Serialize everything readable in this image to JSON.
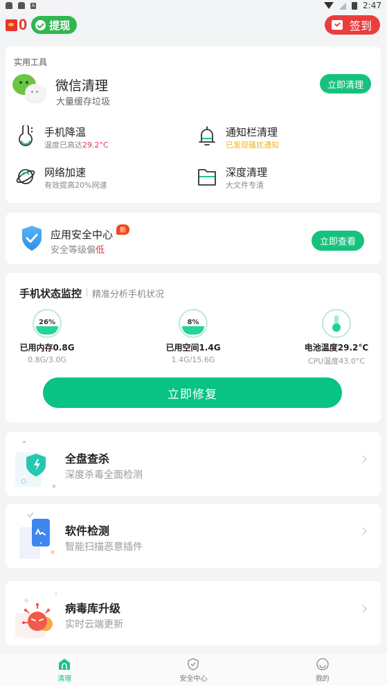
{
  "status_bar": {
    "time": "2:47",
    "left_icons": [
      "notification-icon",
      "notification-icon",
      "app-icon-a"
    ],
    "right_icons": [
      "wifi-icon",
      "no-signal-icon",
      "battery-charging-icon"
    ],
    "app_icon_letter": "A"
  },
  "header": {
    "coin_count": "0",
    "withdraw_label": "提现",
    "checkin_label": "签到"
  },
  "tools": {
    "section_title": "实用工具",
    "wechat": {
      "title": "微信清理",
      "subtitle": "大量缓存垃圾",
      "button": "立即清理"
    },
    "items": [
      {
        "name": "手机降温",
        "sub_prefix": "温度已高达",
        "sub_highlight": "29.2°C",
        "icon": "thermometer-bulb-icon"
      },
      {
        "name": "通知栏清理",
        "sub_highlight": "已发现骚扰通知",
        "icon": "bell-icon"
      },
      {
        "name": "网络加速",
        "sub_prefix": "有效提高20%网速",
        "icon": "planet-icon"
      },
      {
        "name": "深度清理",
        "sub_prefix": "大文件专清",
        "icon": "folder-icon"
      }
    ]
  },
  "security_center": {
    "title": "应用安全中心",
    "badge": "新",
    "subtitle_prefix": "安全等级偏",
    "subtitle_highlight": "低",
    "button": "立即查看"
  },
  "monitor": {
    "title": "手机状态监控",
    "subtitle": "精准分析手机状况",
    "gauges": [
      {
        "percent_label": "26%",
        "percent": 26,
        "label": "已用内存0.8G",
        "sub": "0.8G/3.0G"
      },
      {
        "percent_label": "8%",
        "percent": 8,
        "label": "已用空间1.4G",
        "sub": "1.4G/15.6G"
      },
      {
        "label": "电池温度29.2°C",
        "sub": "CPU温度43.0°C"
      }
    ],
    "fix_button": "立即修复"
  },
  "features": [
    {
      "title": "全盘查杀",
      "subtitle": "深度杀毒全面检测"
    },
    {
      "title": "软件检测",
      "subtitle": "智能扫描恶意插件"
    },
    {
      "title": "病毒库升级",
      "subtitle": "实时云端更新"
    }
  ],
  "tabbar": {
    "tabs": [
      {
        "label": "清理",
        "active": true
      },
      {
        "label": "安全中心",
        "active": false
      },
      {
        "label": "我的",
        "active": false
      }
    ]
  },
  "colors": {
    "accent_green": "#15c27d",
    "warning_red": "#e8344a",
    "warning_yellow": "#f2b30f",
    "checkin_red": "#ea3d3d",
    "withdraw_green": "#2fb84f"
  }
}
